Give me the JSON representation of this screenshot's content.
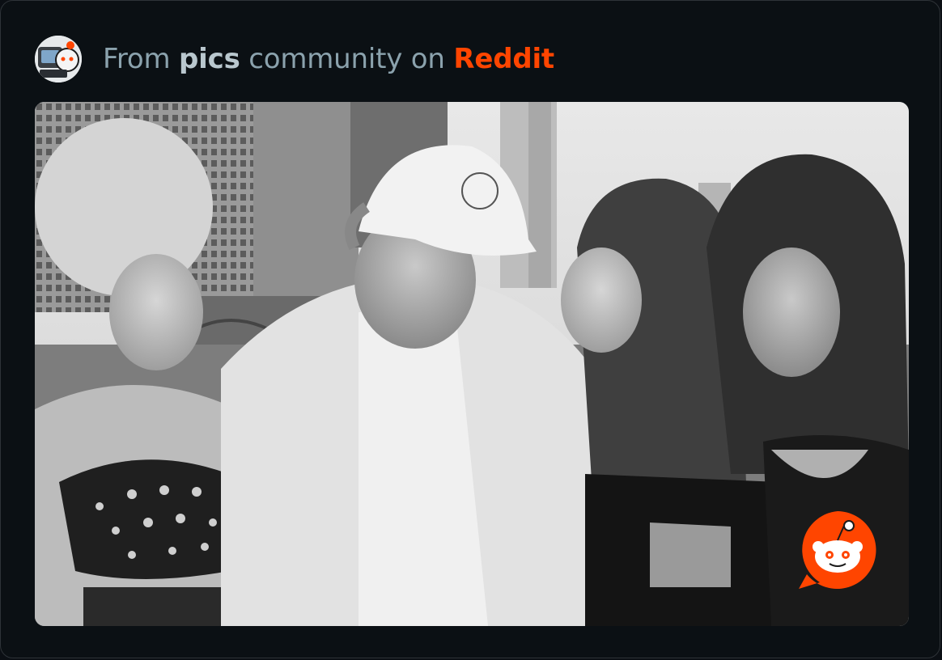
{
  "embed": {
    "prefix": "From ",
    "community": "pics",
    "middle": " community on ",
    "platform": "Reddit"
  },
  "photo": {
    "description_icon": "photo",
    "logo_icon": "reddit-snoo-icon"
  },
  "colors": {
    "background": "#0b1014",
    "border": "#2e3338",
    "text_muted": "#8ba2ad",
    "text_bold": "#b9c7ce",
    "reddit_orange": "#ff4500"
  }
}
